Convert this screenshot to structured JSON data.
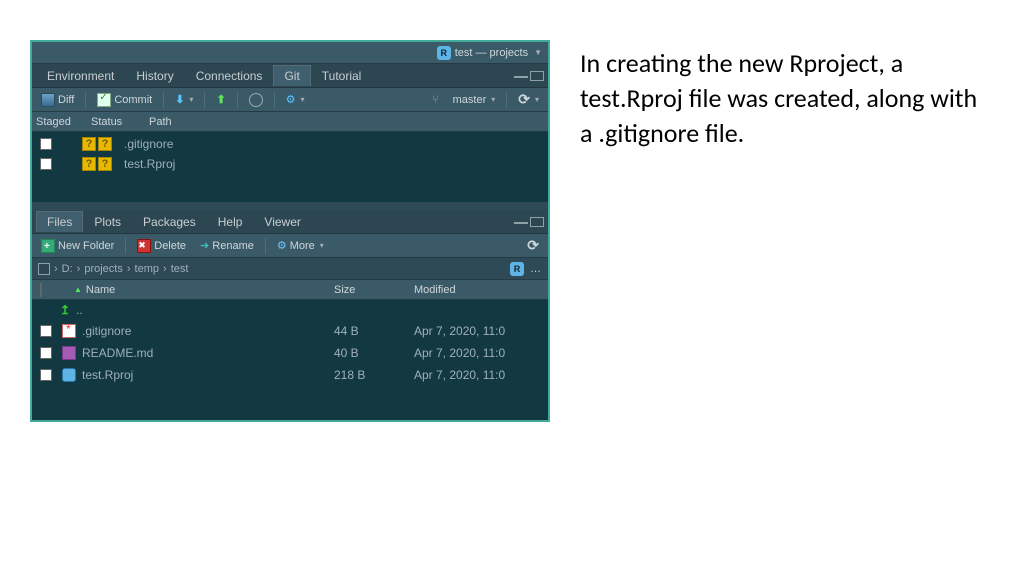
{
  "project": {
    "label": "test — projects"
  },
  "git": {
    "tabs": [
      "Environment",
      "History",
      "Connections",
      "Git",
      "Tutorial"
    ],
    "active_tab": "Git",
    "toolbar": {
      "diff_label": "Diff",
      "commit_label": "Commit",
      "branch_label": "master"
    },
    "headers": {
      "staged": "Staged",
      "status": "Status",
      "path": "Path"
    },
    "rows": [
      {
        "path": ".gitignore"
      },
      {
        "path": "test.Rproj"
      }
    ]
  },
  "files": {
    "tabs": [
      "Files",
      "Plots",
      "Packages",
      "Help",
      "Viewer"
    ],
    "active_tab": "Files",
    "toolbar": {
      "new_folder": "New Folder",
      "delete": "Delete",
      "rename": "Rename",
      "more": "More"
    },
    "breadcrumb": [
      "D:",
      "projects",
      "temp",
      "test"
    ],
    "headers": {
      "name": "Name",
      "size": "Size",
      "modified": "Modified"
    },
    "updir": "..",
    "rows": [
      {
        "name": ".gitignore",
        "size": "44 B",
        "modified": "Apr 7, 2020, 11:0"
      },
      {
        "name": "README.md",
        "size": "40 B",
        "modified": "Apr 7, 2020, 11:0"
      },
      {
        "name": "test.Rproj",
        "size": "218 B",
        "modified": "Apr 7, 2020, 11:0"
      }
    ]
  },
  "caption": "In creating the new Rproject, a test.Rproj file was created, along with a .gitignore file."
}
